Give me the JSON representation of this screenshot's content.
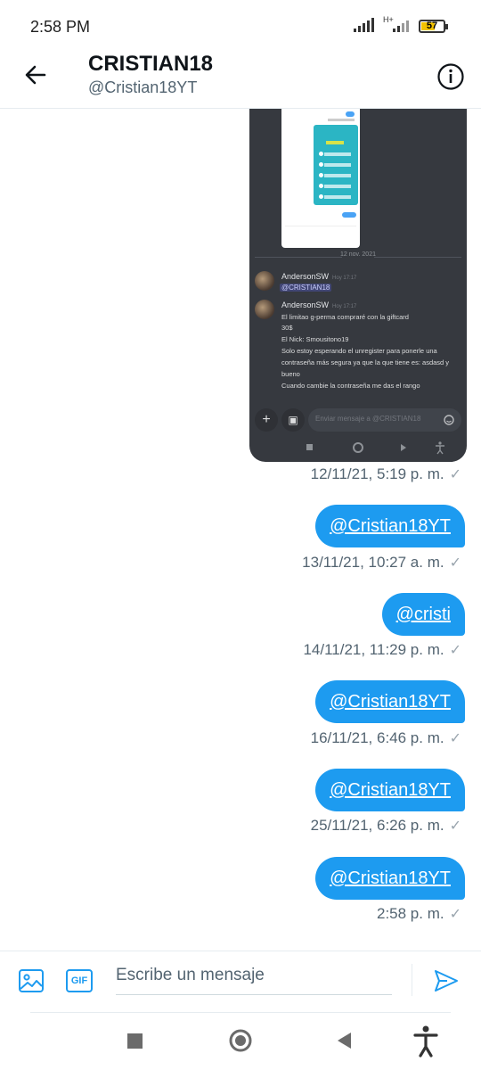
{
  "status": {
    "time": "2:58 PM",
    "network": "H+",
    "battery": "57"
  },
  "header": {
    "title": "CRISTIAN18",
    "subtitle": "@Cristian18YT"
  },
  "embedded_image": {
    "date_divider": "12 nov. 2021",
    "messages": [
      {
        "author": "AndersonSW",
        "time": "Hoy 17:17",
        "mention": "@CRISTIAN18"
      },
      {
        "author": "AndersonSW",
        "time": "Hoy 17:17",
        "lines": [
          "El limitao g-perma compraré con la giftcard",
          "30$",
          "El Nick: Smousitono19",
          "Solo estoy esperando el unregister para ponerle una",
          "contraseña más segura ya que la que tiene es: asdasd y",
          "bueno",
          "Cuando cambie la contraseña me das el rango"
        ]
      }
    ],
    "input_placeholder": "Enviar mensaje a @CRISTIAN18"
  },
  "conversation": [
    {
      "timestamp": "12/11/21, 5:19 p. m."
    },
    {
      "text": "@Cristian18YT",
      "timestamp": "13/11/21, 10:27 a. m."
    },
    {
      "text": "@cristi",
      "timestamp": "14/11/21, 11:29 p. m."
    },
    {
      "text": "@Cristian18YT",
      "timestamp": "16/11/21, 6:46 p. m."
    },
    {
      "text": "@Cristian18YT",
      "timestamp": "25/11/21, 6:26 p. m."
    },
    {
      "text": "@Cristian18YT",
      "timestamp": "2:58 p. m."
    }
  ],
  "composer": {
    "gif_label": "GIF",
    "placeholder": "Escribe un mensaje"
  },
  "colors": {
    "accent": "#1d9bf0",
    "discord_bg": "#36393f"
  }
}
